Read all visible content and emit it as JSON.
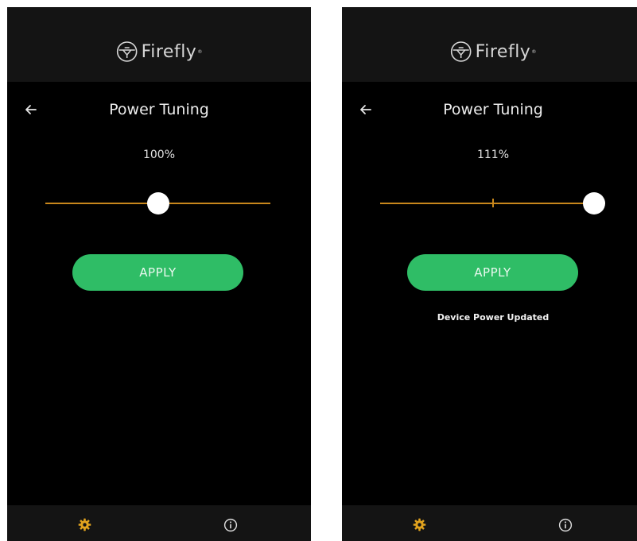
{
  "colors": {
    "accent_track": "#c8871c",
    "accent_gear": "#e0a21e",
    "apply_button": "#2fbd66",
    "background": "#000000",
    "header_bg": "#141414"
  },
  "screens": [
    {
      "brand": {
        "name": "Firefly",
        "reg": "®",
        "icon": "firefly-logo-icon"
      },
      "nav": {
        "back_icon": "back-arrow-icon"
      },
      "title": "Power Tuning",
      "power_percent": "100%",
      "slider": {
        "level": 0.5,
        "tick": null
      },
      "apply_label": "APPLY",
      "status_message": "",
      "footer": {
        "settings_icon": "gear-icon",
        "info_icon": "info-icon"
      }
    },
    {
      "brand": {
        "name": "Firefly",
        "reg": "®",
        "icon": "firefly-logo-icon"
      },
      "nav": {
        "back_icon": "back-arrow-icon"
      },
      "title": "Power Tuning",
      "power_percent": "111%",
      "slider": {
        "level": 0.95,
        "tick": 0.5
      },
      "apply_label": "APPLY",
      "status_message": "Device Power Updated",
      "footer": {
        "settings_icon": "gear-icon",
        "info_icon": "info-icon"
      }
    }
  ]
}
